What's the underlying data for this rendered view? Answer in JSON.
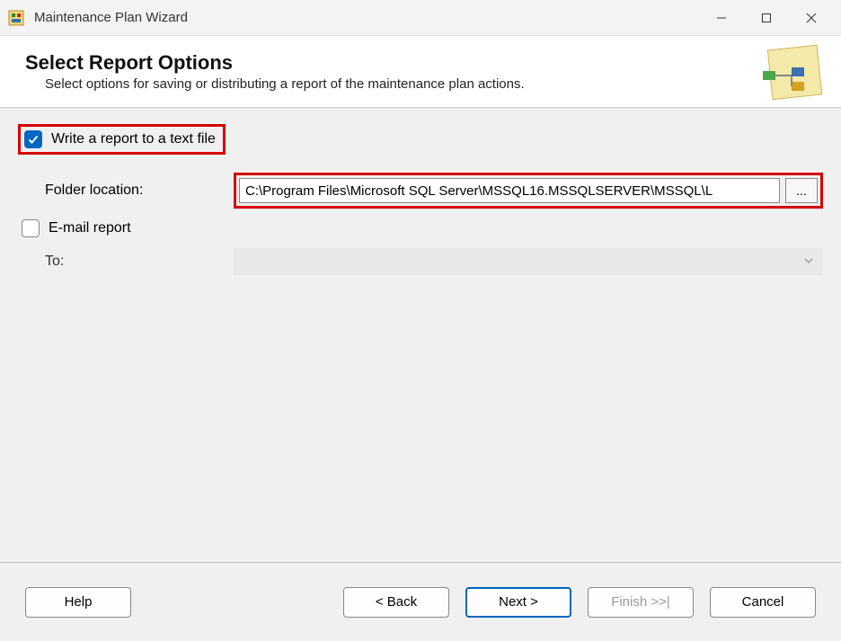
{
  "window": {
    "title": "Maintenance Plan Wizard"
  },
  "header": {
    "title": "Select Report Options",
    "subtitle": "Select options for saving or distributing a report of the maintenance plan actions."
  },
  "options": {
    "write_report_label": "Write a report to a text file",
    "write_report_checked": true,
    "folder_location_label": "Folder location:",
    "folder_location_value": "C:\\Program Files\\Microsoft SQL Server\\MSSQL16.MSSQLSERVER\\MSSQL\\L",
    "browse_label": "...",
    "email_report_label": "E-mail report",
    "email_report_checked": false,
    "to_label": "To:",
    "to_value": ""
  },
  "buttons": {
    "help": "Help",
    "back": "< Back",
    "next": "Next >",
    "finish": "Finish >>|",
    "cancel": "Cancel"
  }
}
